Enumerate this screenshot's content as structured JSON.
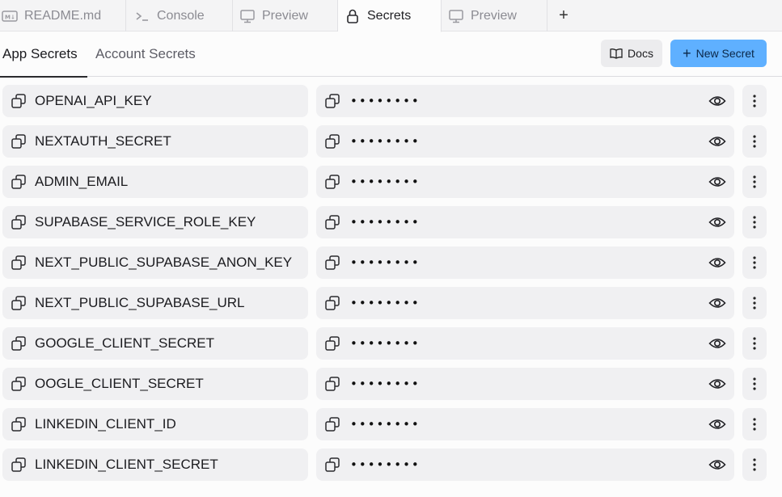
{
  "tabs": [
    {
      "label": "README.md",
      "icon": "markdown-icon",
      "active": false
    },
    {
      "label": "Console",
      "icon": "terminal-icon",
      "active": false
    },
    {
      "label": "Preview",
      "icon": "monitor-icon",
      "active": false
    },
    {
      "label": "Secrets",
      "icon": "lock-icon",
      "active": true
    },
    {
      "label": "Preview",
      "icon": "monitor-icon",
      "active": false
    }
  ],
  "add_tab_label": "+",
  "subtabs": {
    "app": "App Secrets",
    "account": "Account Secrets"
  },
  "buttons": {
    "docs": "Docs",
    "new_secret": "New Secret"
  },
  "colors": {
    "accent": "#5fb0ff",
    "row_bg": "#f0f0f2"
  },
  "secrets": [
    {
      "key": "OPENAI_API_KEY",
      "value_masked": "••••••••"
    },
    {
      "key": "NEXTAUTH_SECRET",
      "value_masked": "••••••••"
    },
    {
      "key": "ADMIN_EMAIL",
      "value_masked": "••••••••"
    },
    {
      "key": "SUPABASE_SERVICE_ROLE_KEY",
      "value_masked": "••••••••"
    },
    {
      "key": "NEXT_PUBLIC_SUPABASE_ANON_KEY",
      "value_masked": "••••••••"
    },
    {
      "key": "NEXT_PUBLIC_SUPABASE_URL",
      "value_masked": "••••••••"
    },
    {
      "key": "GOOGLE_CLIENT_SECRET",
      "value_masked": "••••••••"
    },
    {
      "key": "OOGLE_CLIENT_SECRET",
      "value_masked": "••••••••"
    },
    {
      "key": "LINKEDIN_CLIENT_ID",
      "value_masked": "••••••••"
    },
    {
      "key": "LINKEDIN_CLIENT_SECRET",
      "value_masked": "••••••••"
    }
  ]
}
